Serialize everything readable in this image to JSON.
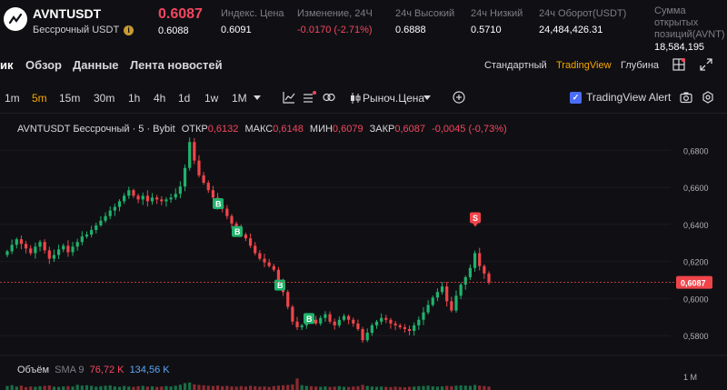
{
  "header": {
    "symbol": "AVNTUSDT",
    "subtitle": "Бессрочный USDT",
    "last_price": "0.6087",
    "mark_price": "0.6088",
    "stats": [
      {
        "label": "Индекс. Цена",
        "value": "0.6091",
        "negative": false
      },
      {
        "label": "Изменение, 24Ч",
        "value": "-0.0170 (-2.71%)",
        "negative": true
      },
      {
        "label": "24ч Высокий",
        "value": "0.6888",
        "negative": false
      },
      {
        "label": "24ч Низкий",
        "value": "0.5710",
        "negative": false
      },
      {
        "label": "24ч Оборот(USDT)",
        "value": "24,484,426.31",
        "negative": false
      },
      {
        "label": "Сумма открытых позиций(AVNT)",
        "value": "18,584,195",
        "negative": false
      }
    ]
  },
  "tabs": {
    "items": [
      "ик",
      "Обзор",
      "Данные",
      "Лента новостей"
    ],
    "active_index": 0,
    "views": [
      "Стандартный",
      "TradingView",
      "Глубина"
    ],
    "active_view": 1
  },
  "toolbar": {
    "timeframes": [
      "1m",
      "5m",
      "15m",
      "30m",
      "1h",
      "4h",
      "1d",
      "1w",
      "1M"
    ],
    "active_timeframe": 1,
    "price_type": "Рыноч.Цена",
    "alert_label": "TradingView Alert"
  },
  "legend": {
    "title": "AVNTUSDT Бессрочный · 5 · Bybit",
    "open_label": "ОТКР",
    "open": "0,6132",
    "high_label": "МАКС",
    "high": "0,6148",
    "low_label": "МИН",
    "low": "0,6079",
    "close_label": "ЗАКР",
    "close": "0,6087",
    "change": "-0,0045 (-0,73%)"
  },
  "volume": {
    "label": "Объём",
    "sma_label": "SMA 9",
    "value1": "76,72 K",
    "value2": "134,56 K",
    "axis_label": "1 M"
  },
  "chart_data": {
    "type": "candlestick",
    "y_ticks": [
      "0,6800",
      "0,6600",
      "0,6400",
      "0,6200",
      "0,6000",
      "0,5800"
    ],
    "y_tick_values": [
      0.68,
      0.66,
      0.64,
      0.62,
      0.6,
      0.58
    ],
    "ylim": [
      0.5712,
      0.691
    ],
    "current_price": 0.6087,
    "current_price_label": "0,6087",
    "closes": [
      0.6255,
      0.629,
      0.632,
      0.6295,
      0.627,
      0.6245,
      0.628,
      0.6305,
      0.626,
      0.6215,
      0.6235,
      0.6265,
      0.6285,
      0.625,
      0.628,
      0.6305,
      0.6335,
      0.6345,
      0.637,
      0.6395,
      0.642,
      0.6445,
      0.6475,
      0.6495,
      0.6525,
      0.6555,
      0.6585,
      0.6555,
      0.6535,
      0.6555,
      0.6525,
      0.6545,
      0.6535,
      0.6525,
      0.6535,
      0.6545,
      0.6565,
      0.6605,
      0.6705,
      0.6845,
      0.6745,
      0.6665,
      0.6625,
      0.6585,
      0.6545,
      0.6505,
      0.6485,
      0.6445,
      0.6405,
      0.6385,
      0.6345,
      0.6325,
      0.6285,
      0.6245,
      0.6215,
      0.6195,
      0.6175,
      0.6155,
      0.6095,
      0.6035,
      0.5955,
      0.5875,
      0.5845,
      0.5855,
      0.5905,
      0.5885,
      0.5865,
      0.5895,
      0.5915,
      0.5875,
      0.5855,
      0.5885,
      0.5905,
      0.5885,
      0.5865,
      0.5835,
      0.5775,
      0.5815,
      0.5855,
      0.5875,
      0.5895,
      0.5885,
      0.5865,
      0.5855,
      0.5845,
      0.5835,
      0.5825,
      0.5855,
      0.5885,
      0.5925,
      0.5965,
      0.6005,
      0.6035,
      0.6065,
      0.5985,
      0.5935,
      0.6015,
      0.6075,
      0.6115,
      0.6165,
      0.6245,
      0.6175,
      0.6135,
      0.6087
    ],
    "buy_markers": [
      0.6512,
      0.6362,
      0.6072,
      0.5892
    ],
    "buy_marker_label": "B",
    "sell_marker_label": "S",
    "sell_markers": [
      0.6436
    ],
    "volume_rel": [
      0.35,
      0.42,
      0.3,
      0.38,
      0.25,
      0.31,
      0.28,
      0.33,
      0.36,
      0.4,
      0.29,
      0.27,
      0.31,
      0.34,
      0.3,
      0.45,
      0.38,
      0.41,
      0.36,
      0.29,
      0.33,
      0.37,
      0.4,
      0.31,
      0.28,
      0.35,
      0.3,
      0.27,
      0.33,
      0.36,
      0.29,
      0.32,
      0.27,
      0.3,
      0.34,
      0.31,
      0.37,
      0.46,
      0.6,
      0.65,
      0.5,
      0.44,
      0.41,
      0.37,
      0.35,
      0.39,
      0.33,
      0.36,
      0.31,
      0.29,
      0.34,
      0.3,
      0.37,
      0.33,
      0.29,
      0.31,
      0.27,
      0.34,
      0.38,
      0.41,
      0.44,
      0.48,
      1.0,
      0.42,
      0.36,
      0.33,
      0.3,
      0.28,
      0.31,
      0.27,
      0.29,
      0.33,
      0.28,
      0.26,
      0.3,
      0.33,
      0.45,
      0.35,
      0.31,
      0.28,
      0.3,
      0.27,
      0.25,
      0.29,
      0.26,
      0.24,
      0.28,
      0.3,
      0.33,
      0.35,
      0.38,
      0.32,
      0.29,
      0.31,
      0.36,
      0.33,
      0.37,
      0.4,
      0.38,
      0.36,
      0.44,
      0.39,
      0.35,
      0.3
    ]
  }
}
